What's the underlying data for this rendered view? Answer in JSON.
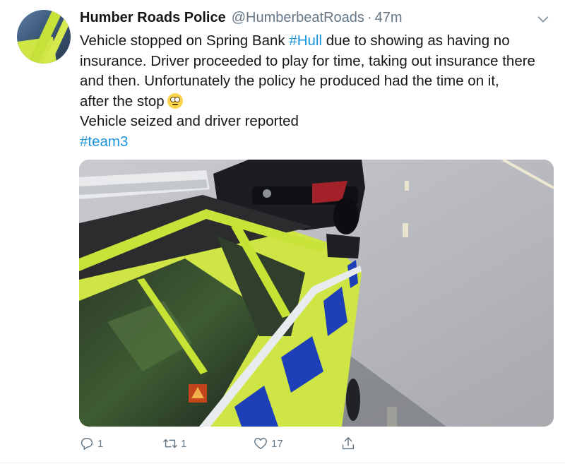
{
  "tweet": {
    "author_name": "Humber Roads Police",
    "handle": "@HumberbeatRoads",
    "separator": "·",
    "time": "47m",
    "lines": [
      {
        "before": "Vehicle stopped on Spring Bank ",
        "hashtag": "#Hull",
        "after": " due to showing as having no"
      },
      {
        "text": "insurance. Driver proceeded to play for time, taking out insurance there"
      },
      {
        "text": "and then. Unfortunately the policy he produced had the time on it,"
      },
      {
        "text": "after the stop",
        "emoji": "flushed-face-emoji"
      },
      {
        "text": "Vehicle seized and driver reported"
      },
      {
        "hashtag": "#team3"
      }
    ],
    "photo_icon": "police-car-photo",
    "actions": {
      "reply_count": "1",
      "retweet_count": "1",
      "like_count": "17"
    }
  },
  "colors": {
    "link": "#1b95e0",
    "secondary_text": "#657786",
    "primary_text": "#14171a",
    "police_yellow": "#c8e23a",
    "police_blue": "#1d3fb8"
  }
}
